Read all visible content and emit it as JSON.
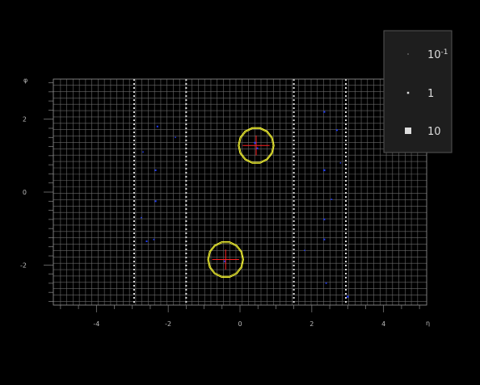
{
  "chart_data": {
    "type": "scatter",
    "title": "",
    "xlabel": "η",
    "ylabel": "φ",
    "xlim": [
      -5.2,
      5.2
    ],
    "ylim": [
      -3.1,
      3.1
    ],
    "x_ticks": [
      -4,
      -2,
      0,
      2,
      4
    ],
    "y_ticks": [
      -2,
      0,
      2
    ],
    "grid": true,
    "legend_placement": "top-right",
    "legend": [
      {
        "base": "10",
        "exp": "-1",
        "value": 0.1
      },
      {
        "base": "1",
        "exp": "",
        "value": 1
      },
      {
        "base": "10",
        "exp": "",
        "value": 10
      }
    ],
    "jets": [
      {
        "eta": 0.45,
        "phi": 1.28,
        "radius": 0.5
      },
      {
        "eta": -0.4,
        "phi": -1.85,
        "radius": 0.5
      }
    ],
    "deposits": [
      {
        "eta": 0.42,
        "phi": 1.35,
        "e": 3
      },
      {
        "eta": 0.48,
        "phi": 1.2,
        "e": 2
      },
      {
        "eta": -0.42,
        "phi": -1.9,
        "e": 2
      },
      {
        "eta": -2.3,
        "phi": 1.8,
        "e": 1
      },
      {
        "eta": -2.35,
        "phi": 0.6,
        "e": 1
      },
      {
        "eta": -2.35,
        "phi": -0.25,
        "e": 1
      },
      {
        "eta": -2.4,
        "phi": -1.3,
        "e": 0.5
      },
      {
        "eta": -2.6,
        "phi": -1.35,
        "e": 1
      },
      {
        "eta": -2.7,
        "phi": 1.1,
        "e": 0.3
      },
      {
        "eta": -2.75,
        "phi": -0.7,
        "e": 0.3
      },
      {
        "eta": 2.35,
        "phi": 2.2,
        "e": 1
      },
      {
        "eta": 2.35,
        "phi": 0.6,
        "e": 2
      },
      {
        "eta": 2.55,
        "phi": -0.2,
        "e": 0.5
      },
      {
        "eta": 2.35,
        "phi": -0.75,
        "e": 1
      },
      {
        "eta": 2.35,
        "phi": -1.3,
        "e": 1
      },
      {
        "eta": 2.4,
        "phi": -2.5,
        "e": 0.5
      },
      {
        "eta": 2.7,
        "phi": 1.7,
        "e": 1
      },
      {
        "eta": 2.8,
        "phi": 0.8,
        "e": 0.3
      },
      {
        "eta": 3.0,
        "phi": -2.87,
        "e": 2
      },
      {
        "eta": -1.8,
        "phi": 1.5,
        "e": 0.3
      },
      {
        "eta": 1.8,
        "phi": -1.6,
        "e": 0.3
      }
    ],
    "colors": {
      "background": "#000000",
      "grid": "#6a6a6a",
      "deposit": "#1f3cff",
      "jet_circle": "#ffff33",
      "jet_cross": "#ff2020",
      "legend_bg": "#1e1e1e",
      "legend_border": "#555555"
    }
  }
}
